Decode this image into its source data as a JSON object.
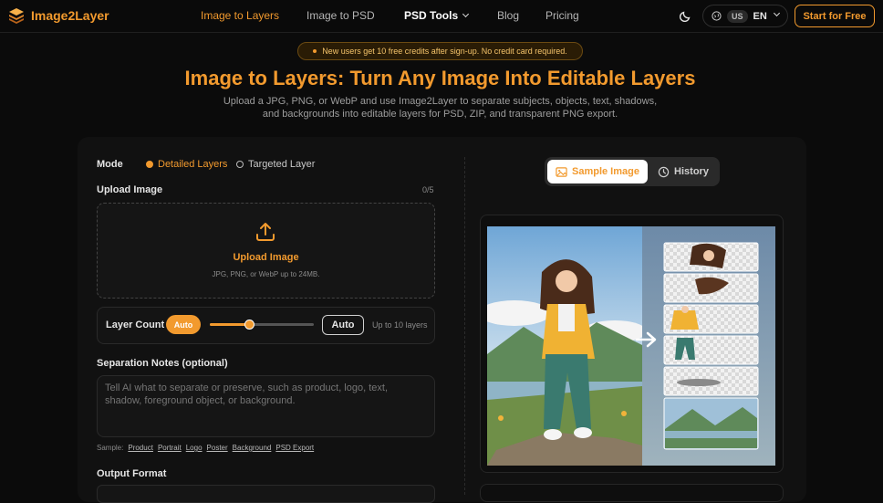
{
  "brand": {
    "name": "Image2Layer",
    "accent": "#f29a2e"
  },
  "nav": {
    "links": [
      {
        "label": "Image to Layers"
      },
      {
        "label": "Image to PSD"
      },
      {
        "label": "PSD Tools"
      },
      {
        "label": "Blog"
      },
      {
        "label": "Pricing"
      }
    ],
    "theme_icon": "moon-icon",
    "language": {
      "icon": "globe-icon",
      "country": "US",
      "code": "EN"
    },
    "cta": "Start for Free"
  },
  "promo": "New users get 10 free credits after sign-up. No credit card required.",
  "hero": {
    "title": "Image to Layers: Turn Any Image Into Editable Layers",
    "subtitle": "Upload a JPG, PNG, or WebP and use Image2Layer to separate subjects, objects, text, shadows, and backgrounds into editable layers for PSD, ZIP, and transparent PNG export."
  },
  "form": {
    "mode_label": "Mode",
    "modes": [
      {
        "label": "Detailed Layers",
        "selected": true
      },
      {
        "label": "Targeted Layer",
        "selected": false
      }
    ],
    "upload": {
      "label": "Upload Image",
      "count": "0/5",
      "icon": "upload-icon",
      "title": "Upload Image",
      "hint": "JPG, PNG, or WebP up to 24MB."
    },
    "layer_count": {
      "label": "Layer Count",
      "pill": "Auto",
      "slider_fraction": 0.38,
      "value": "Auto",
      "hint": "Up to 10 layers"
    },
    "notes": {
      "label": "Separation Notes (optional)",
      "placeholder": "Tell AI what to separate or preserve, such as product, logo, text, shadow, foreground object, or background.",
      "sample_label": "Sample:",
      "samples": [
        "Product",
        "Portrait",
        "Logo",
        "Poster",
        "Background",
        "PSD Export"
      ]
    },
    "output_label": "Output Format"
  },
  "preview": {
    "tabs": [
      {
        "label": "Sample Image",
        "icon": "image-icon",
        "active": true
      },
      {
        "label": "History",
        "icon": "clock-icon",
        "active": false
      }
    ]
  }
}
